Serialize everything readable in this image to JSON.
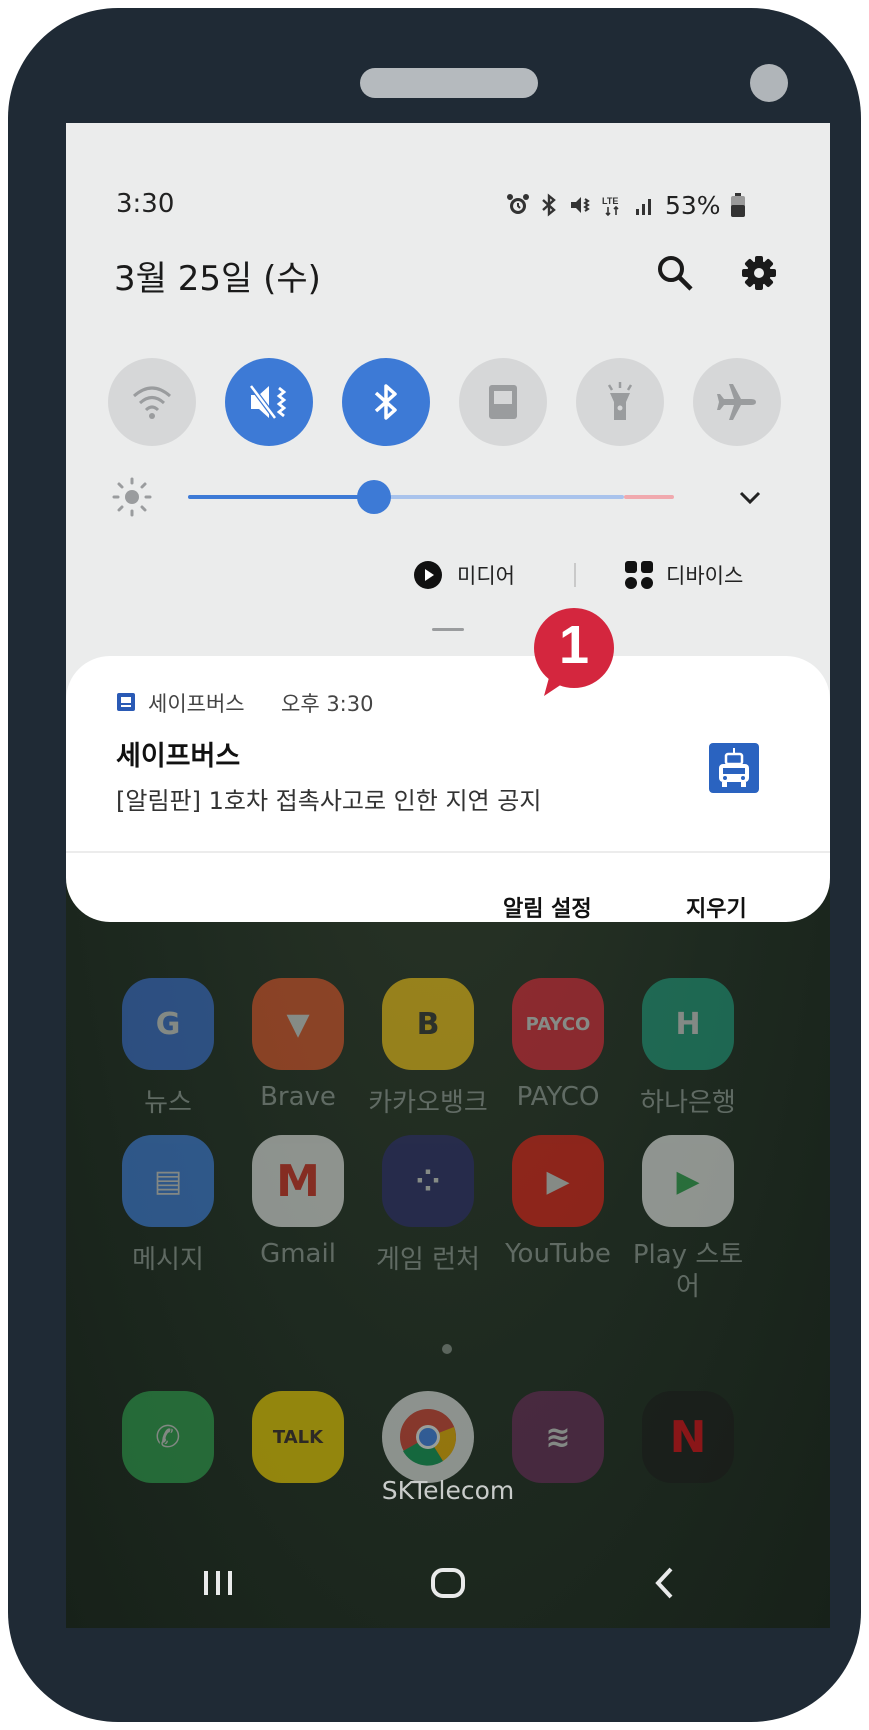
{
  "status_bar": {
    "time": "3:30",
    "battery": "53%"
  },
  "panel": {
    "date": "3월 25일 (수)",
    "tiles": [
      "wifi-icon",
      "mute-vibrate-icon",
      "bluetooth-icon",
      "screen-icon",
      "flashlight-icon",
      "airplane-icon"
    ],
    "media_label": "미디어",
    "devices_label": "디바이스",
    "brightness_fraction": 0.39
  },
  "notification": {
    "app_name": "세이프버스",
    "time": "오후 3:30",
    "title": "세이프버스",
    "body": "[알림판] 1호차 접촉사고로 인한 지연 공지",
    "settings_button": "알림 설정",
    "clear_button": "지우기",
    "marker": "1"
  },
  "home": {
    "apps_row1": [
      "뉴스",
      "Brave",
      "카카오뱅크",
      "PAYCO",
      "하나은행"
    ],
    "apps_row2": [
      "메시지",
      "Gmail",
      "게임 런처",
      "YouTube",
      "Play 스토어"
    ],
    "carrier": "SKTelecom"
  },
  "colors": {
    "accent": "#3d7ad6",
    "marker": "#d4263e",
    "frame": "#1f2a35"
  }
}
